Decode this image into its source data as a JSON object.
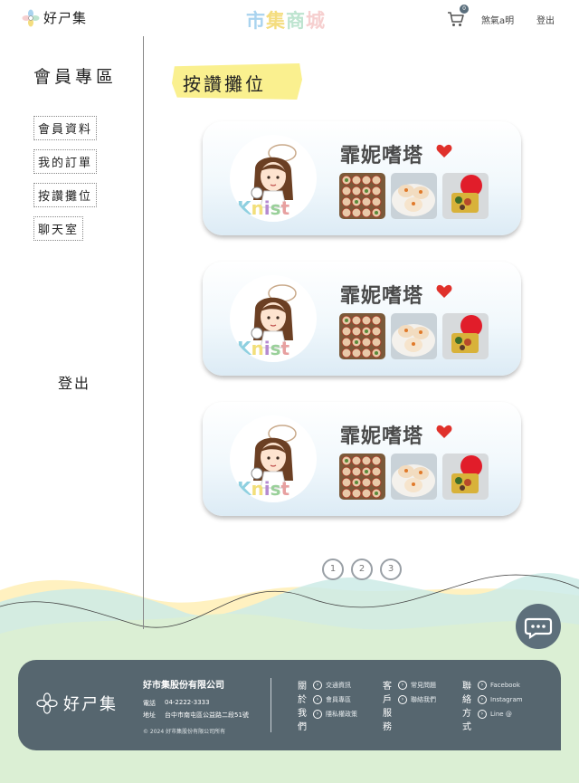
{
  "header": {
    "logo_text": "好ㄕ集",
    "brand_chars": [
      "市",
      "集",
      "商",
      "城"
    ],
    "cart_count": "0",
    "user_name": "煞氣a明",
    "logout_label": "登出"
  },
  "sidebar": {
    "title": "會員專區",
    "items": [
      {
        "label": "會員資料"
      },
      {
        "label": "我的訂單"
      },
      {
        "label": "按讚攤位"
      },
      {
        "label": "聊天室"
      }
    ],
    "logout_label": "登出"
  },
  "page": {
    "title": "按讚攤位"
  },
  "cards": [
    {
      "name": "霏妮嗜塔",
      "avatar_icon": "chef-girl-avatar",
      "photos": [
        "dumplings-grid-photo",
        "buns-plate-photo",
        "bento-box-photo"
      ]
    },
    {
      "name": "霏妮嗜塔",
      "avatar_icon": "chef-girl-avatar",
      "photos": [
        "dumplings-grid-photo",
        "buns-plate-photo",
        "bento-box-photo"
      ]
    },
    {
      "name": "霏妮嗜塔",
      "avatar_icon": "chef-girl-avatar",
      "photos": [
        "dumplings-grid-photo",
        "buns-plate-photo",
        "bento-box-photo"
      ]
    }
  ],
  "avatar_caption": "Knist",
  "pagination": {
    "pages": [
      "1",
      "2",
      "3"
    ]
  },
  "footer": {
    "logo_text": "好ㄕ集",
    "company": "好市集股份有限公司",
    "phone_label": "電話",
    "phone": "04-2222-3333",
    "address_label": "地址",
    "address": "台中市南屯區公益路二段51號",
    "copyright": "© 2024 好市集股份有限公司所有",
    "columns": [
      {
        "title": "關於我們",
        "links": [
          "交通資訊",
          "會員專區",
          "隱私權政策"
        ]
      },
      {
        "title": "客戶服務",
        "links": [
          "常見問題",
          "聯絡我們"
        ]
      },
      {
        "title": "聯絡方式",
        "links": [
          "Facebook",
          "Instagram",
          "Line @"
        ]
      }
    ]
  },
  "colors": {
    "accent_dark": "#56666f",
    "heart": "#e0312b",
    "title_highlight": "#faf08f"
  }
}
